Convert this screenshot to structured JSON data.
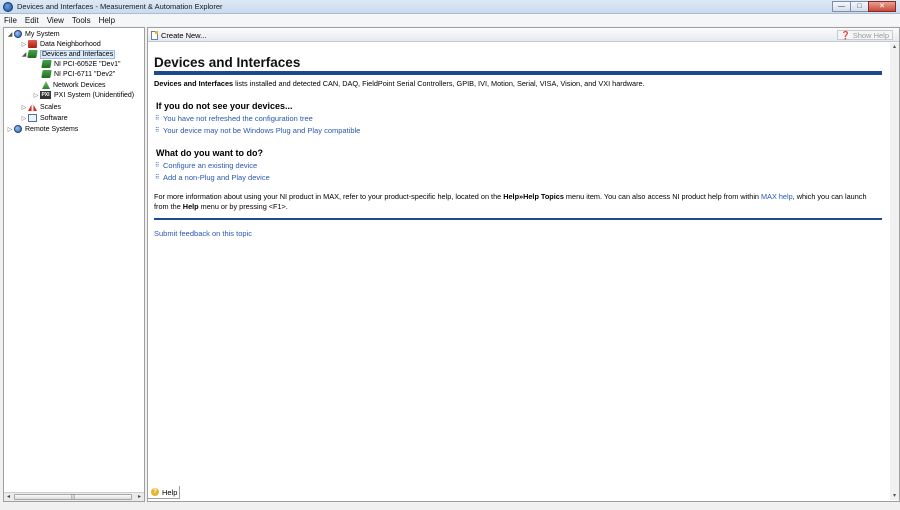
{
  "window": {
    "title": "Devices and Interfaces - Measurement & Automation Explorer",
    "controls": {
      "minimize": "—",
      "maximize": "□",
      "close": "✕"
    }
  },
  "menu": [
    "File",
    "Edit",
    "View",
    "Tools",
    "Help"
  ],
  "tree": {
    "items": [
      {
        "label": "My System",
        "icon": "globe-icon",
        "arrow": "◢"
      },
      {
        "label": "Data Neighborhood",
        "icon": "folder-icon",
        "arrow": "▷"
      },
      {
        "label": "Devices and Interfaces",
        "icon": "board-icon",
        "arrow": "◢"
      },
      {
        "label": "NI PCI-6052E \"Dev1\"",
        "icon": "daq-board-icon",
        "arrow": ""
      },
      {
        "label": "NI PCI-6711 \"Dev2\"",
        "icon": "daq-board-icon",
        "arrow": ""
      },
      {
        "label": "Network Devices",
        "icon": "network-icon",
        "arrow": ""
      },
      {
        "label": "PXI System (Unidentified)",
        "icon": "pxi-icon",
        "icon_text": "PXI",
        "arrow": "▷"
      },
      {
        "label": "Scales",
        "icon": "scales-icon",
        "arrow": "▷"
      },
      {
        "label": "Software",
        "icon": "software-icon",
        "arrow": "▷"
      },
      {
        "label": "Remote Systems",
        "icon": "globe-icon",
        "arrow": "▷"
      }
    ],
    "scroll_left": "◂",
    "scroll_right": "▸",
    "scroll_grip": "|||"
  },
  "toolbar": {
    "create_new": "Create New...",
    "show_help": "Show Help",
    "show_help_icon": "❓"
  },
  "help": {
    "heading": "Devices and Interfaces",
    "intro_bold": "Devices and Interfaces",
    "intro_rest": " lists installed and detected CAN, DAQ, FieldPoint Serial Controllers, GPIB, IVI, Motion, Serial, VISA, Vision, and VXI hardware.",
    "section1_title": "If you do not see your devices...",
    "section1_links": [
      "You have not refreshed the configuration tree",
      "Your device may not be Windows Plug and Play compatible"
    ],
    "section2_title": "What do you want to do?",
    "section2_links": [
      "Configure an existing device",
      "Add a non-Plug and Play device"
    ],
    "bullet": "⠿",
    "more_info_1": "For more information about using your NI product in MAX, refer to your product-specific help, located on the ",
    "more_info_bold_1": "Help»Help Topics",
    "more_info_2": " menu item. You can also access NI product help from within ",
    "more_info_link": "MAX help",
    "more_info_3": ", which you can launch from the ",
    "more_info_bold_2": "Help",
    "more_info_4": " menu or by pressing <F1>.",
    "feedback": "Submit feedback on this topic"
  },
  "scroll": {
    "up": "▴",
    "down": "▾"
  },
  "bottom_tab": {
    "label": "Help",
    "icon_text": "?"
  }
}
